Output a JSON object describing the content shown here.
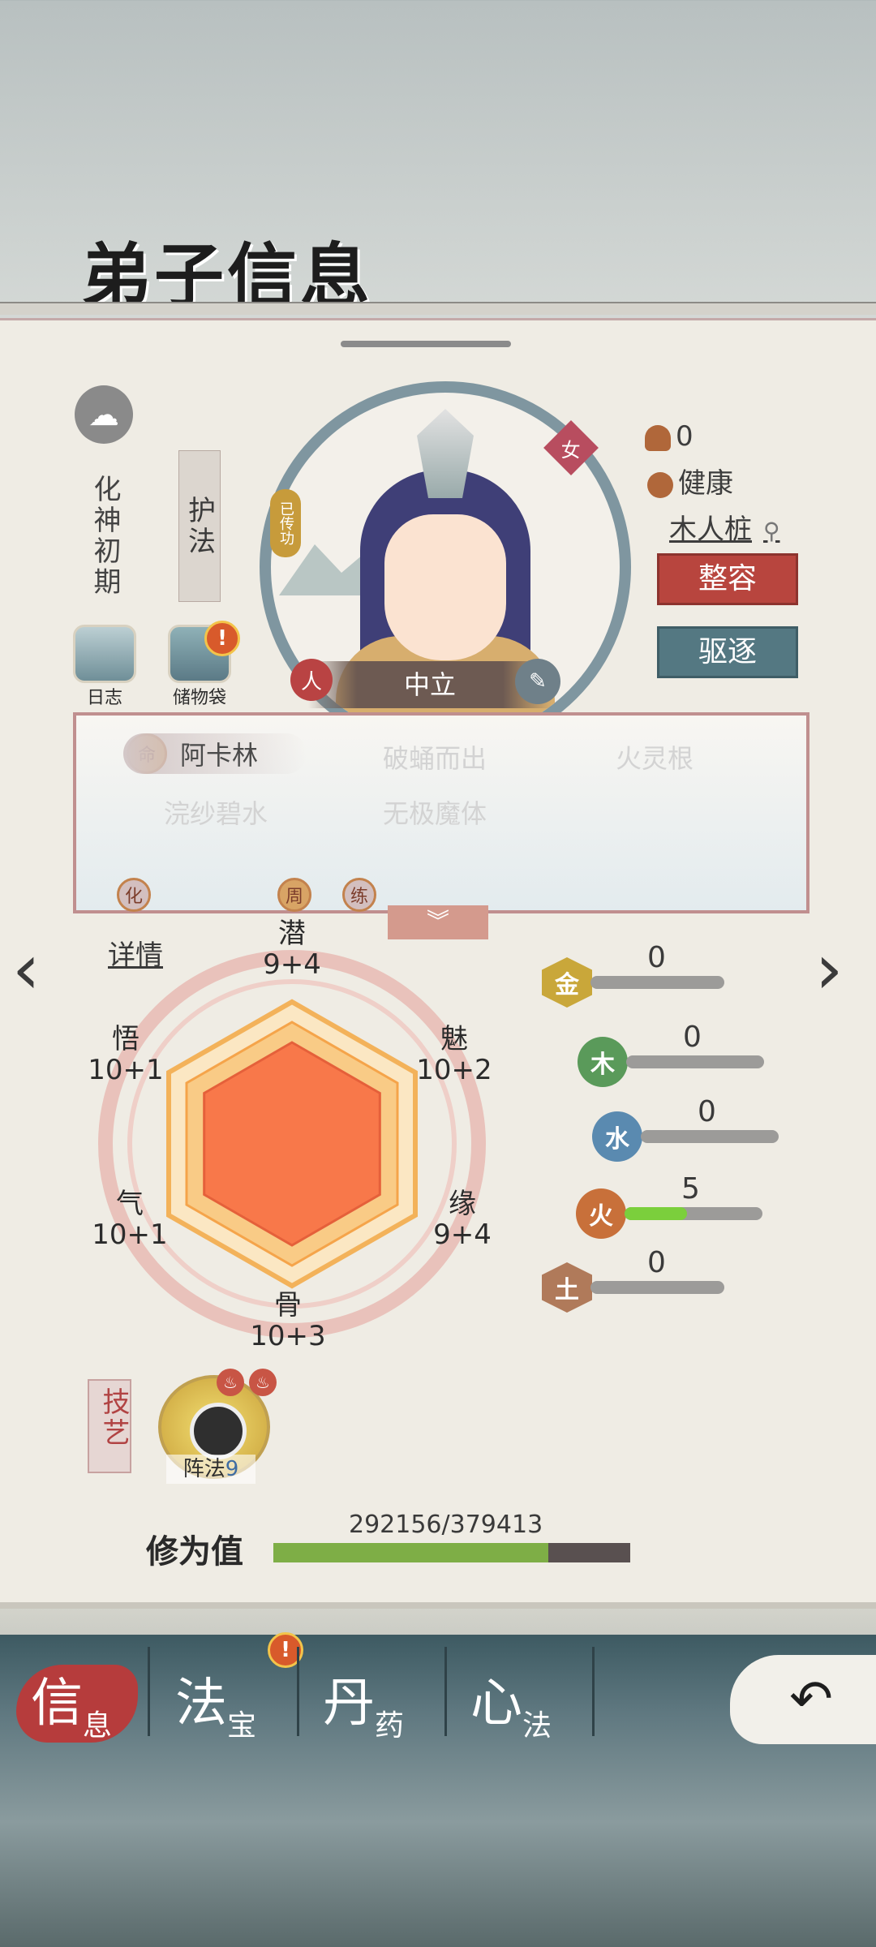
{
  "header": {
    "title": "弟子信息"
  },
  "left_panel": {
    "realm": "化神初期",
    "role_label": "护法",
    "buttons": {
      "log": "日志",
      "bag": "储物袋"
    }
  },
  "portrait": {
    "gender": "女",
    "passed_badge": "已传功",
    "alignment": "中立",
    "alignment_left_icon": "人",
    "alignment_right_icon": "右"
  },
  "right_panel": {
    "count": "0",
    "health": "健康",
    "location": "木人桩",
    "btn_makeover": "整容",
    "btn_expel": "驱逐"
  },
  "traits": {
    "fate_icon": "命",
    "fate": "阿卡林",
    "t2": "破蛹而出",
    "t3": "火灵根",
    "t4": "浣纱碧水",
    "t5": "无极魔体",
    "row3": [
      "化",
      "周",
      "练"
    ]
  },
  "nav": {
    "details": "详情",
    "expand": "︾"
  },
  "radar": {
    "labels": [
      {
        "name": "潜",
        "value": "9+4"
      },
      {
        "name": "魅",
        "value": "10+2"
      },
      {
        "name": "缘",
        "value": "9+4"
      },
      {
        "name": "骨",
        "value": "10+3"
      },
      {
        "name": "气",
        "value": "10+1"
      },
      {
        "name": "悟",
        "value": "10+1"
      }
    ],
    "colors": {
      "outer": "#f7d9a3",
      "inner": "#f8784a"
    }
  },
  "elements": [
    {
      "icon": "金",
      "value": "0",
      "color": "#c9a73a",
      "level": 0
    },
    {
      "icon": "木",
      "value": "0",
      "color": "#5a9a5a",
      "level": 0
    },
    {
      "icon": "水",
      "value": "0",
      "color": "#5a8ab0",
      "level": 0
    },
    {
      "icon": "火",
      "value": "5",
      "color": "#c8703a",
      "level": 0.45
    },
    {
      "icon": "土",
      "value": "0",
      "color": "#b07a5a",
      "level": 0
    }
  ],
  "skills": {
    "tag": "技艺",
    "skill_name": "阵法",
    "skill_level": "9"
  },
  "cultivation": {
    "label": "修为值",
    "value": "292156/379413",
    "progress": 0.77
  },
  "tabs": [
    {
      "big": "信",
      "small": "息",
      "active": true
    },
    {
      "big": "法",
      "small": "宝",
      "active": false,
      "alert": "!"
    },
    {
      "big": "丹",
      "small": "药",
      "active": false
    },
    {
      "big": "心",
      "small": "法",
      "active": false
    }
  ],
  "back_button": "↶"
}
